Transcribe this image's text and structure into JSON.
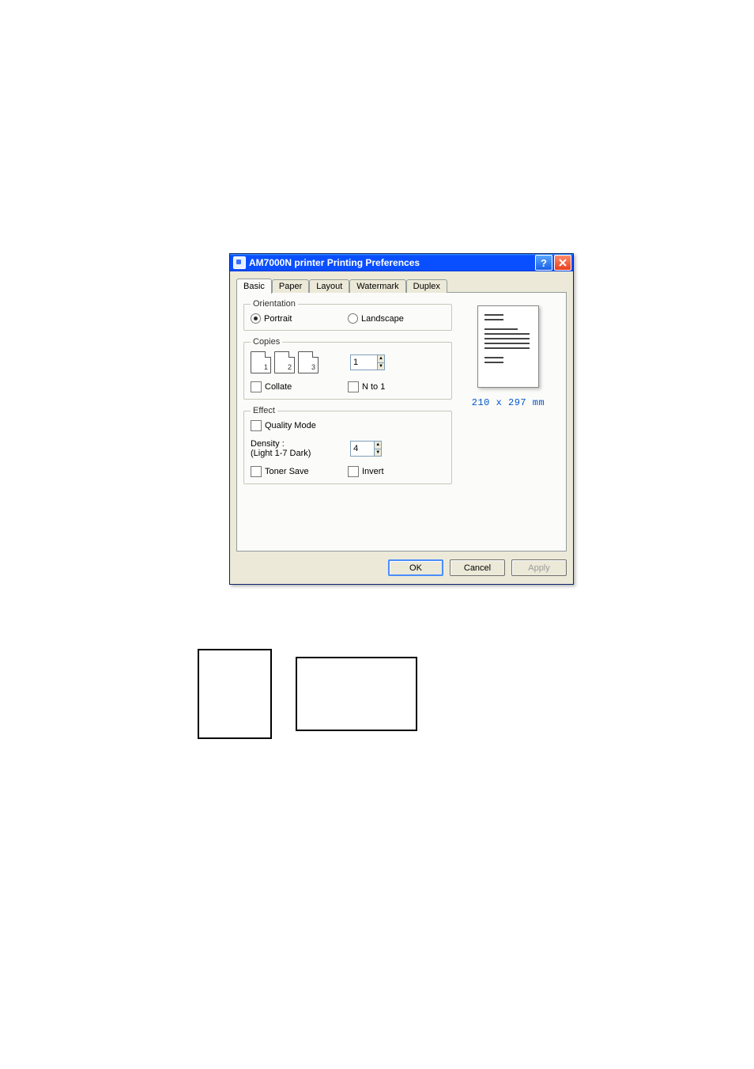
{
  "dialog": {
    "title": "AM7000N printer Printing Preferences"
  },
  "tabs": {
    "basic": "Basic",
    "paper": "Paper",
    "layout": "Layout",
    "watermark": "Watermark",
    "duplex": "Duplex"
  },
  "orientation": {
    "legend": "Orientation",
    "portrait": "Portrait",
    "landscape": "Landscape"
  },
  "copies": {
    "legend": "Copies",
    "count_value": "1",
    "collate": "Collate",
    "nto1": "N to 1",
    "icon1": "1",
    "icon2": "2",
    "icon3": "3"
  },
  "effect": {
    "legend": "Effect",
    "quality_mode": "Quality Mode",
    "density_label": "Density :",
    "density_sub": "(Light 1-7 Dark)",
    "density_value": "4",
    "toner_save": "Toner Save",
    "invert": "Invert"
  },
  "preview": {
    "paper_size": "210 x 297 mm"
  },
  "buttons": {
    "ok": "OK",
    "cancel": "Cancel",
    "apply": "Apply"
  }
}
